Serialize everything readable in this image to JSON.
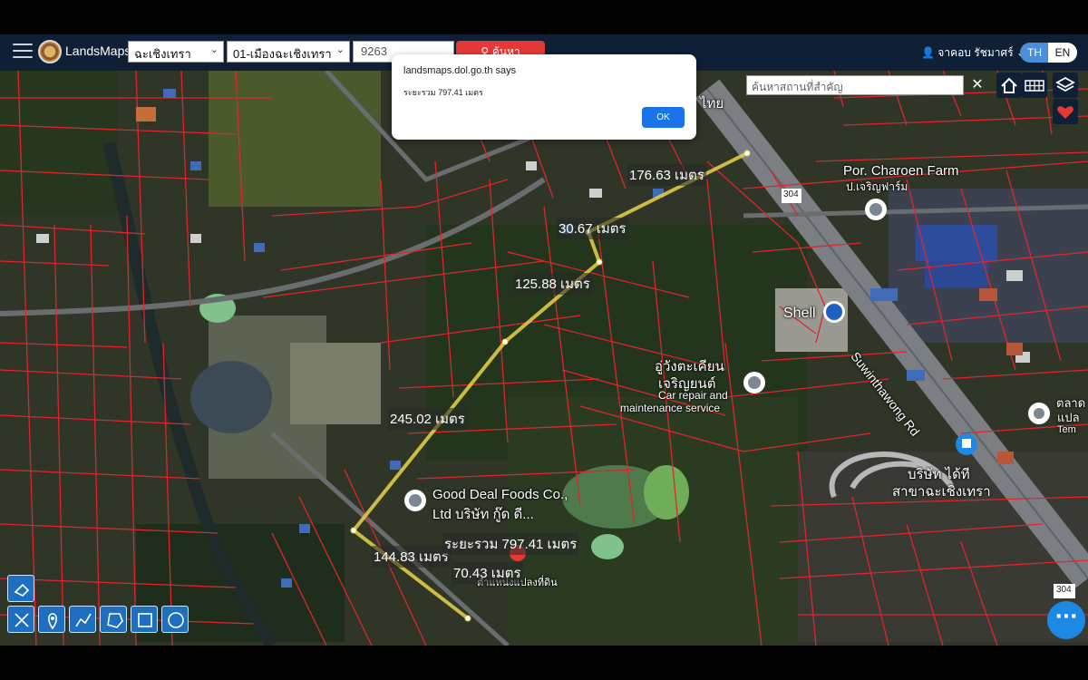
{
  "header": {
    "brand": "LandsMaps",
    "province_select": "ฉะเชิงเทรา",
    "district_select": "01-เมืองฉะเชิงเทรา",
    "parcel_input": "9263",
    "search_label": "ค้นหา",
    "user_name": "จาคอบ รัชมาศร์",
    "lang_th": "TH",
    "lang_en": "EN"
  },
  "dialog": {
    "title": "landsmaps.dol.go.th says",
    "message": "ระยะรวม 797.41 เมตร",
    "ok_label": "OK"
  },
  "map": {
    "place_search_placeholder": "ค้นหาสถานที่สำคัญ",
    "measurements": [
      "176.63 เมตร",
      "30.67 เมตร",
      "125.88 เมตร",
      "245.02 เมตร",
      "144.83 เมตร",
      "70.43 เมตร"
    ],
    "total_label": "ระยะรวม 797.41 เมตร",
    "places": {
      "por_charoen_en": "Por. Charoen Farm",
      "por_charoen_th": "ป.เจริญฟาร์ม",
      "shell": "Shell",
      "repair_th1": "อู่วังตะเคียน",
      "repair_th2": "เจริญยนต์",
      "repair_en1": "Car repair and",
      "repair_en2": "maintenance service",
      "road": "Suwinthawong Rd",
      "company_th1": "บริษัท ได้ที",
      "company_th2": "สาขาฉะเชิงเทรา",
      "gooddeal1": "Good Deal Foods Co.,",
      "gooddeal2": "Ltd บริษัท กู๊ด ดี...",
      "parcel_pos": "ตำแหน่งแปลงที่ดิน",
      "thai_top": "ไทย",
      "market1": "ตลาด",
      "market2": "แปล",
      "market3": "Tem",
      "route_badge": "304",
      "route_badge2": "304"
    }
  },
  "colors": {
    "header_bg": "#0f1f36",
    "accent_blue": "#1a73e8",
    "search_red": "#e53935",
    "parcel_line": "#e0252b",
    "measure_line": "#e8d24a"
  }
}
